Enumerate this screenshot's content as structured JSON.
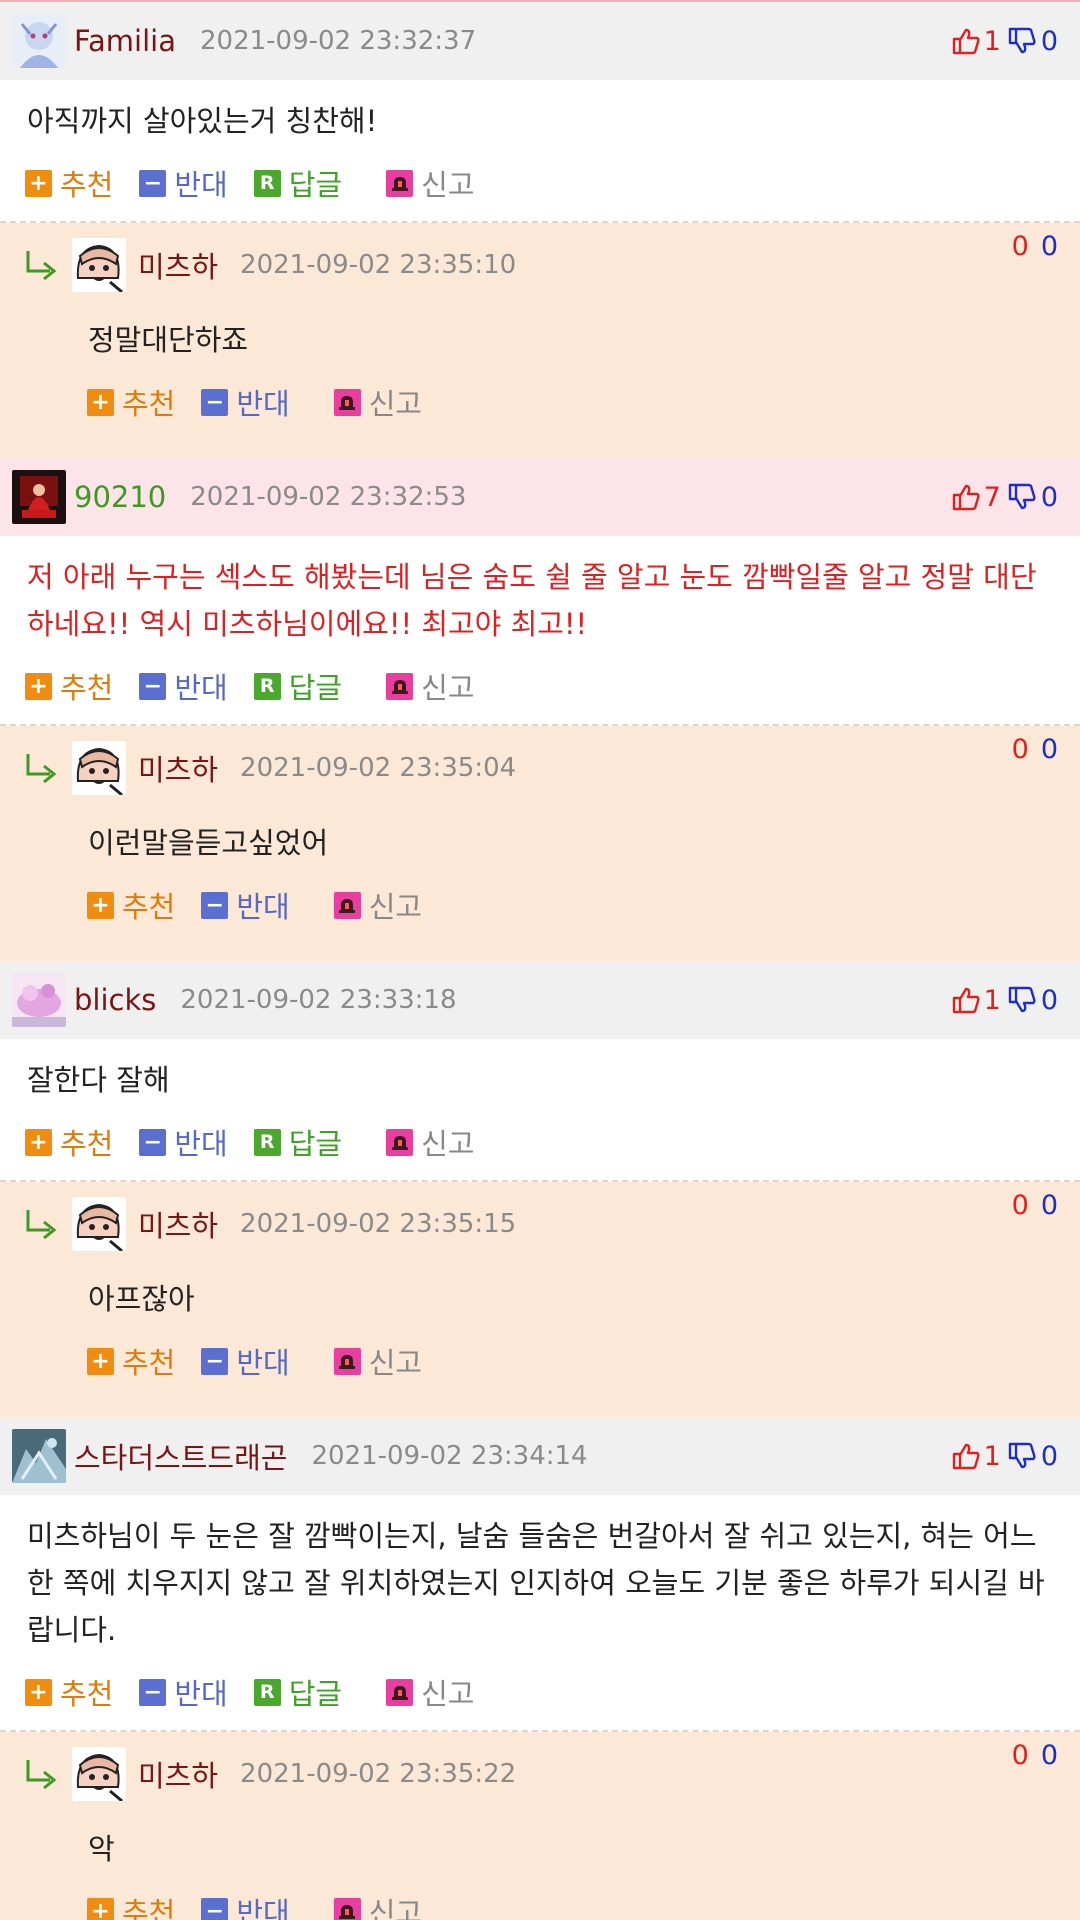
{
  "ui": {
    "recommend": "추천",
    "oppose": "반대",
    "reply": "답글",
    "report": "신고",
    "reply_badge": "R"
  },
  "comments": [
    {
      "nick": "Familia",
      "time": "2021-09-02 23:32:37",
      "up": "1",
      "down": "0",
      "text": "아직까지 살아있는거 칭찬해!",
      "reply": {
        "nick": "미츠하",
        "time": "2021-09-02 23:35:10",
        "up": "0",
        "down": "0",
        "text": "정말대단하죠"
      }
    },
    {
      "nick": "90210",
      "time": "2021-09-02 23:32:53",
      "up": "7",
      "down": "0",
      "text": "저 아래 누구는 섹스도 해봤는데 님은 숨도 쉴 줄 알고 눈도 깜빡일줄 알고 정말 대단하네요!! 역시 미츠하님이에요!! 최고야 최고!!",
      "reply": {
        "nick": "미츠하",
        "time": "2021-09-02 23:35:04",
        "up": "0",
        "down": "0",
        "text": "이런말을듣고싶었어"
      }
    },
    {
      "nick": "blicks",
      "time": "2021-09-02 23:33:18",
      "up": "1",
      "down": "0",
      "text": "잘한다 잘해",
      "reply": {
        "nick": "미츠하",
        "time": "2021-09-02 23:35:15",
        "up": "0",
        "down": "0",
        "text": "아프잖아"
      }
    },
    {
      "nick": "스타더스트드래곤",
      "time": "2021-09-02 23:34:14",
      "up": "1",
      "down": "0",
      "text": "미츠하님이 두 눈은 잘 깜빡이는지, 날숨 들숨은 번갈아서 잘 쉬고 있는지, 혀는 어느 한 쪽에 치우지지 않고 잘 위치하였는지 인지하여 오늘도 기분 좋은 하루가 되시길 바랍니다.",
      "reply": {
        "nick": "미츠하",
        "time": "2021-09-02 23:35:22",
        "up": "0",
        "down": "0",
        "text": "악"
      }
    }
  ]
}
